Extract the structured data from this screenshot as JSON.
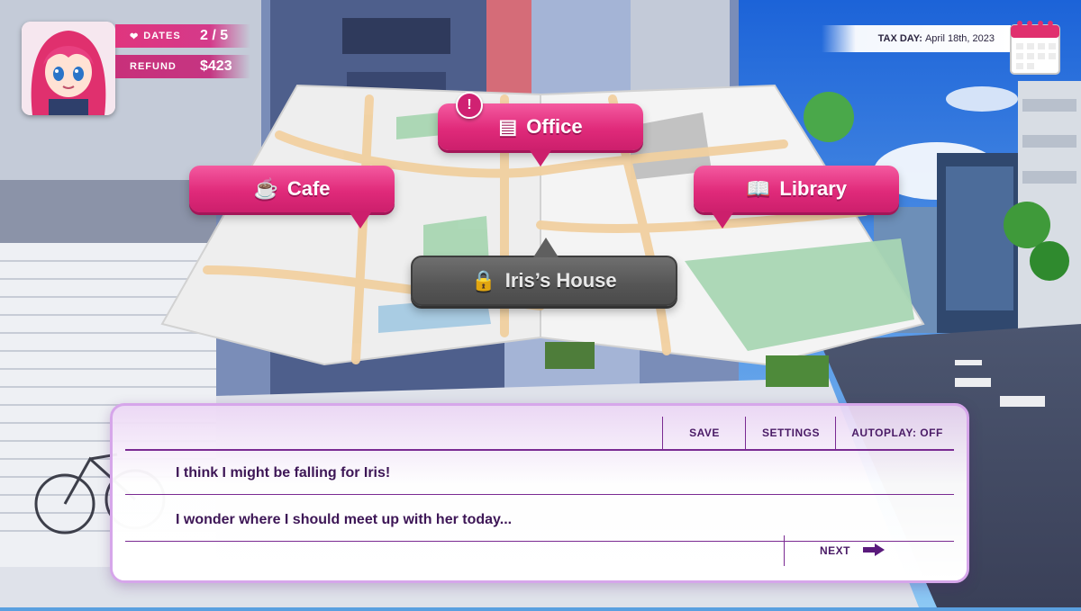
{
  "hud": {
    "dates_label": "DATES",
    "dates_value": "2 / 5",
    "refund_label": "REFUND",
    "refund_value": "$423"
  },
  "tax_day": {
    "label": "TAX DAY:",
    "date": "April 18th, 2023"
  },
  "map": {
    "locations": [
      {
        "name": "Office",
        "icon": "document-icon",
        "state": "alert"
      },
      {
        "name": "Cafe",
        "icon": "coffee-cup-icon",
        "state": "available"
      },
      {
        "name": "Library",
        "icon": "open-book-icon",
        "state": "available"
      },
      {
        "name": "Iris’s House",
        "icon": "lock-icon",
        "state": "locked"
      }
    ],
    "alert_mark": "!"
  },
  "dialog": {
    "buttons": {
      "save": "SAVE",
      "settings": "SETTINGS",
      "autoplay": "AUTOPLAY: OFF"
    },
    "lines": [
      "I think I might be falling for Iris!",
      "I wonder where I should meet up with her today..."
    ],
    "next_label": "NEXT"
  },
  "colors": {
    "accent_pink": "#e02a7a",
    "locked_gray": "#555555",
    "dialog_purple": "#7a2a92"
  }
}
